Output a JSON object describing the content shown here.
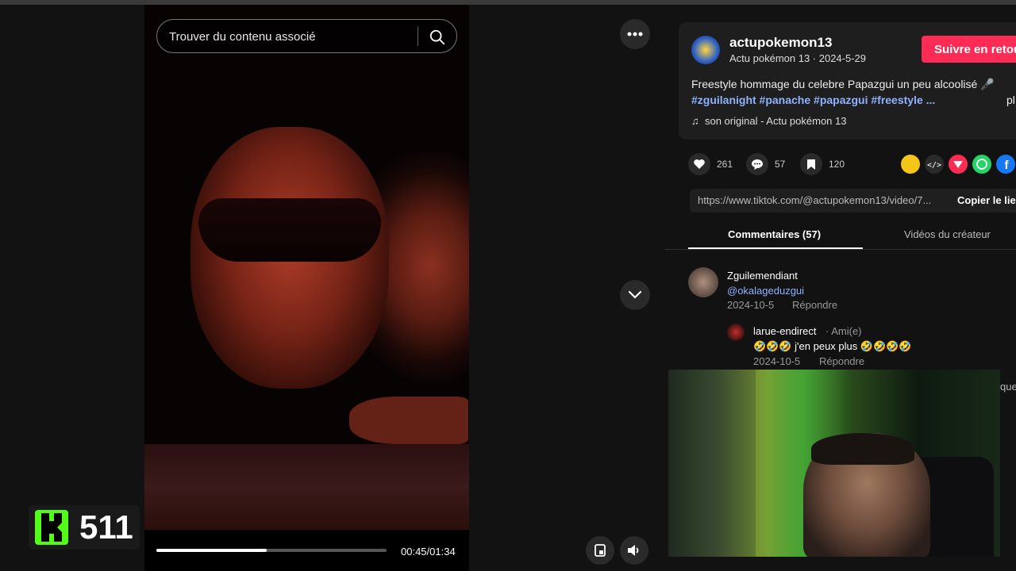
{
  "search": {
    "placeholder": "Trouver du contenu associé"
  },
  "player": {
    "progress": 0.48,
    "time": "00:45/01:34"
  },
  "badge": {
    "count": "511"
  },
  "author": {
    "username": "actupokemon13",
    "line": "Actu pokémon 13 · 2024-5-29",
    "follow_label": "Suivre en retour"
  },
  "post": {
    "description": "Freestyle hommage du celebre Papazgui un peu alcoolisé 🎤",
    "hashtags": "#zguilanight #panache #papazgui #freestyle ...",
    "more": "pl",
    "music": "son original - Actu pokémon 13"
  },
  "stats": {
    "likes": "261",
    "comments": "57",
    "saves": "120"
  },
  "share_colors": [
    "#f5c518",
    "#2a2a2a",
    "#fe2c55",
    "#25d366",
    "#1877f2"
  ],
  "link": {
    "url": "https://www.tiktok.com/@actupokemon13/video/7...",
    "copy_label": "Copier le lien"
  },
  "tabs": {
    "comments": "Commentaires (57)",
    "videos": "Vidéos du créateur"
  },
  "comments": [
    {
      "name": "Zguilemendiant",
      "text": "@okalageduzgui",
      "date": "2024-10-5",
      "reply": "Répondre"
    }
  ],
  "replies": [
    {
      "name": "larue-endirect",
      "tag": "· Ami(e)",
      "text": "🤣🤣🤣 j'en peux plus 🤣🤣🤣🤣",
      "date": "2024-10-5",
      "reply": "Répondre"
    }
  ],
  "side_text": "que"
}
